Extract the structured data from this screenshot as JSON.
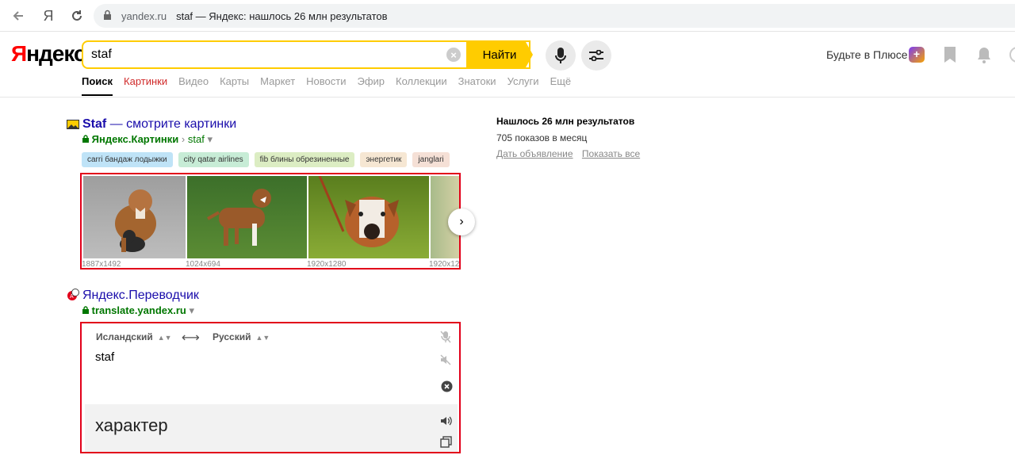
{
  "browser": {
    "back_icon": "arrow-left-icon",
    "yandex_icon": "yandex-y-icon",
    "reload_icon": "reload-icon",
    "lock_icon": "lock-icon",
    "domain": "yandex.ru",
    "page_title": "staf — Яндекс: нашлось 26 млн результатов"
  },
  "header": {
    "logo": "Яндекс",
    "search_value": "staf",
    "find_label": "Найти",
    "plus_text": "Будьте в Плюсе",
    "plus_badge": "+"
  },
  "tabs": [
    {
      "label": "Поиск",
      "active": true
    },
    {
      "label": "Картинки",
      "red": true
    },
    {
      "label": "Видео"
    },
    {
      "label": "Карты"
    },
    {
      "label": "Маркет"
    },
    {
      "label": "Новости"
    },
    {
      "label": "Эфир"
    },
    {
      "label": "Коллекции"
    },
    {
      "label": "Знатоки"
    },
    {
      "label": "Услуги"
    },
    {
      "label": "Ещё"
    }
  ],
  "images_result": {
    "title_bold": "Staf",
    "title_rest": " — смотрите картинки",
    "path_site": "Яндекс.Картинки",
    "path_sep": "›",
    "path_query": "staf",
    "chips": [
      {
        "label": "carri бандаж лодыжки",
        "color": "#bfe3f7"
      },
      {
        "label": "city qatar airlines",
        "color": "#c7ecd6"
      },
      {
        "label": "fib блины обрезиненные",
        "color": "#dcedc3"
      },
      {
        "label": "энергетик",
        "color": "#f6e7d3"
      },
      {
        "label": "janglari",
        "color": "#f5e0d6"
      }
    ],
    "images": [
      {
        "size": "1887x1492"
      },
      {
        "size": "1024x694"
      },
      {
        "size": "1920x1280"
      },
      {
        "size": "1920x12"
      }
    ]
  },
  "translator_result": {
    "title": "Яндекс.Переводчик",
    "url": "translate.yandex.ru",
    "source_lang": "Исландский",
    "target_lang": "Русский",
    "source_text": "staf",
    "translation": "характер"
  },
  "sidebar": {
    "found": "Нашлось 26 млн результатов",
    "impressions": "705 показов в месяц",
    "ad_link": "Дать объявление",
    "show_all_link": "Показать все"
  },
  "colors": {
    "accent_yellow": "#ffcc00",
    "link_blue": "#1a0dab",
    "url_green": "#007700",
    "highlight_red": "#e2001a"
  }
}
